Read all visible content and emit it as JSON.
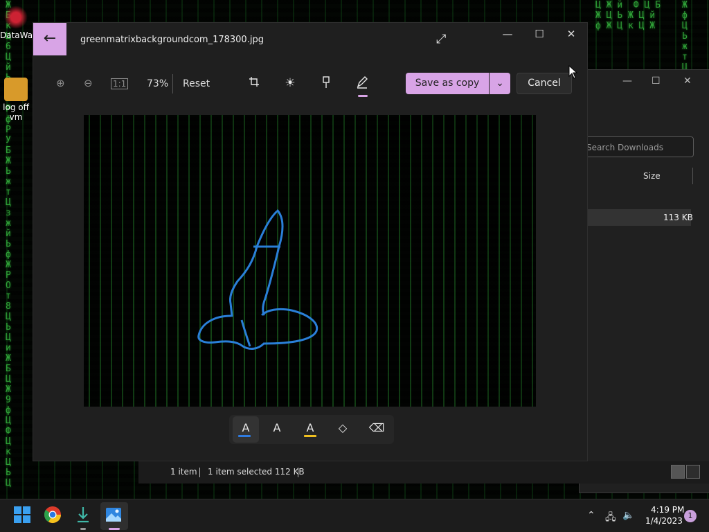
{
  "desktop": {
    "icons": [
      {
        "label": "DataWag"
      },
      {
        "label": "log off vm"
      }
    ]
  },
  "photos_window": {
    "title": "greenmatrixbackgroundcom_178300.jpg",
    "zoom": "73%",
    "reset_label": "Reset",
    "save_label": "Save as copy",
    "cancel_label": "Cancel",
    "window_controls": {
      "minimize": "—",
      "maximize": "☐",
      "close": "✕"
    },
    "tools": [
      "crop-icon",
      "brightness-icon",
      "filter-icon",
      "markup-icon"
    ],
    "selected_tool": "markup-icon",
    "pen_tools": [
      {
        "name": "ballpoint-pen",
        "color": "#2f7be0"
      },
      {
        "name": "pencil",
        "color": "#e8e8e8"
      },
      {
        "name": "highlighter",
        "color": "#f0c020"
      },
      {
        "name": "eraser",
        "color": ""
      },
      {
        "name": "erase-all",
        "color": ""
      }
    ],
    "accent": "#d8a4e6"
  },
  "explorer": {
    "search_placeholder": "Search Downloads",
    "size_header": "Size",
    "file_size": "113 KB",
    "status": {
      "items": "1 item",
      "selected": "1 item selected  112 KB"
    }
  },
  "taskbar": {
    "time": "4:19 PM",
    "date": "1/4/2023",
    "notifications": "1"
  }
}
